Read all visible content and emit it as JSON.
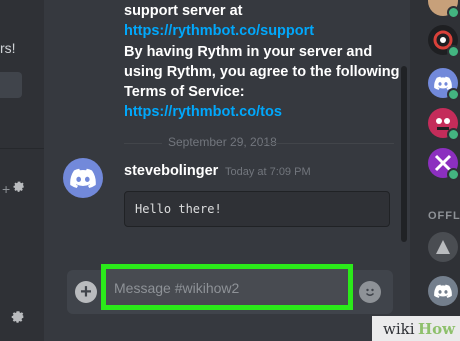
{
  "left_sidebar": {
    "fragment_text": "rs!",
    "plus_glyph": "+"
  },
  "messages": {
    "system_text_lines": [
      "support server at",
      "By having Rythm in your server and",
      "using Rythm, you agree to the following",
      "Terms of Service:"
    ],
    "links": {
      "support": "https://rythmbot.co/support",
      "tos": "https://rythmbot.co/tos"
    },
    "date_separator": "September 29, 2018",
    "user_message": {
      "username": "stevebolinger",
      "timestamp": "Today at 7:09 PM",
      "code": "Hello there!"
    }
  },
  "composer": {
    "plus_glyph": "+",
    "placeholder": "Message #wikihow2"
  },
  "member_list": {
    "offline_label": "OFFL"
  },
  "watermark": {
    "part1": "wiki",
    "part2": "How"
  },
  "colors": {
    "background": "#36393f",
    "sidebar": "#2f3136",
    "link": "#00a8fc",
    "blurple": "#7289da",
    "highlight": "#2bea1a",
    "online": "#43b581"
  },
  "icons": [
    "gear-icon",
    "discord-logo-icon",
    "plus-icon",
    "emoji-icon"
  ]
}
